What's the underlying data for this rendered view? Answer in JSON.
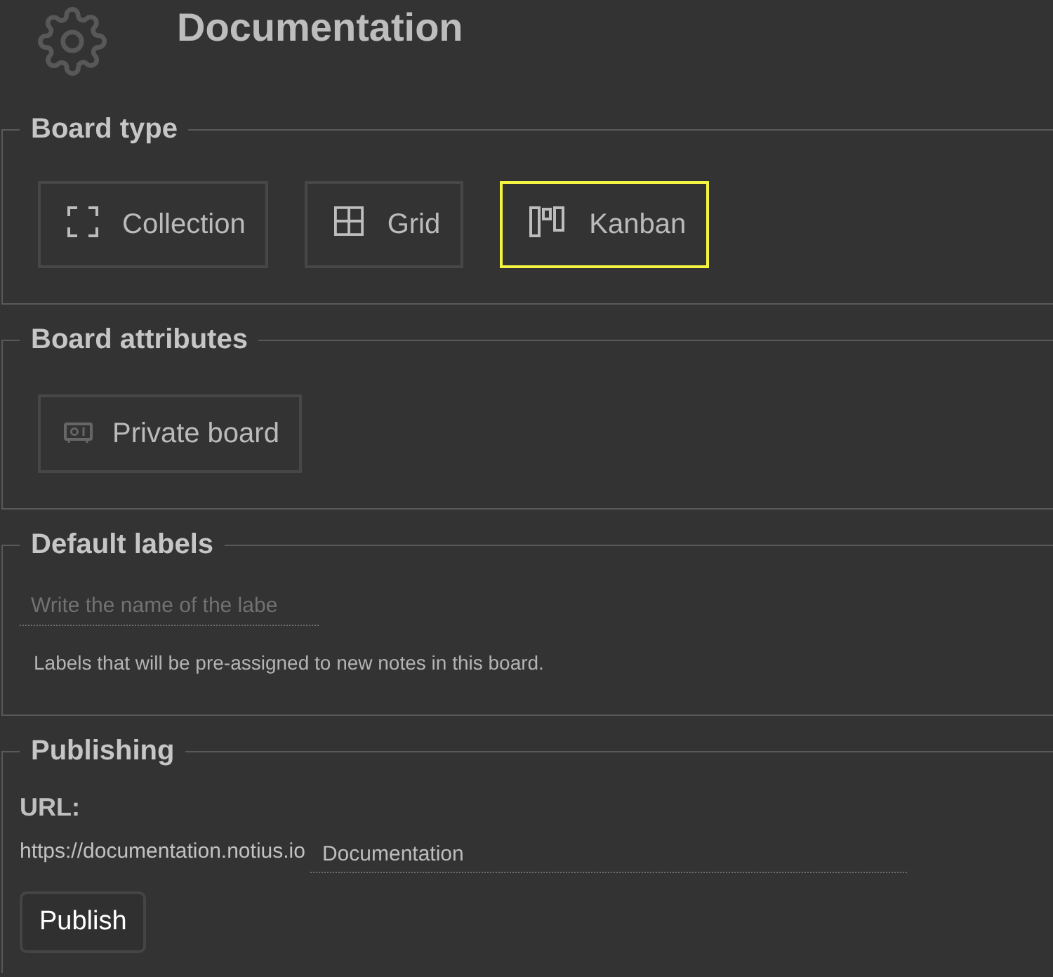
{
  "header": {
    "title": "Documentation"
  },
  "board_type": {
    "legend": "Board type",
    "options": [
      {
        "kind": "collection",
        "label": "Collection",
        "selected": false
      },
      {
        "kind": "grid",
        "label": "Grid",
        "selected": false
      },
      {
        "kind": "kanban",
        "label": "Kanban",
        "selected": true
      }
    ]
  },
  "board_attributes": {
    "legend": "Board attributes",
    "options": [
      {
        "kind": "private",
        "label": "Private board",
        "on": false
      }
    ]
  },
  "default_labels": {
    "legend": "Default labels",
    "input": {
      "placeholder": "Write the name of the labe"
    },
    "help": "Labels that will be pre-assigned to new notes in this board."
  },
  "publishing": {
    "legend": "Publishing",
    "url_label": "URL:",
    "url_prefix": "https://documentation.notius.io",
    "slug_input": {
      "value": "Documentation"
    },
    "button": "Publish"
  }
}
